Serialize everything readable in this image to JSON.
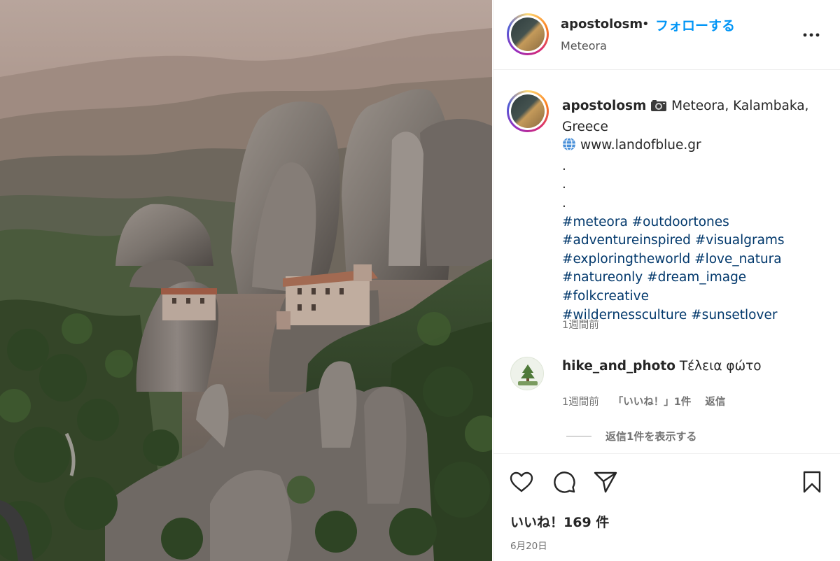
{
  "post": {
    "username": "apostolosm",
    "separator": "•",
    "follow_label": "フォローする",
    "location": "Meteora",
    "more_icon": "more-horizontal-icon"
  },
  "caption": {
    "username": "apostolosm",
    "camera_icon": "camera-icon",
    "location_text": " Meteora, Kalambaka, Greece",
    "globe_icon": "globe-icon",
    "website": "www.landofblue.gr",
    "dot1": ".",
    "dot2": ".",
    "dot3": ".",
    "hashtags_line1": "#meteora #outdoortones",
    "hashtags_line2": "#adventureinspired #visualgrams",
    "hashtags_line3": "#exploringtheworld #love_natura",
    "hashtags_line4": "#natureonly #dream_image #folkcreative",
    "hashtags_line5": "#wildernessculture #sunsetlover",
    "time": "1週間前"
  },
  "comment": {
    "username": "hike_and_photo",
    "text": "Τέλεια φώτο",
    "time": "1週間前",
    "likes": "「いいね！」1件",
    "reply_label": "返信",
    "view_replies": "返信1件を表示する"
  },
  "actions": {
    "like_icon": "heart-icon",
    "comment_icon": "comment-icon",
    "share_icon": "share-icon",
    "save_icon": "bookmark-icon"
  },
  "likes_text": "いいね！169 件",
  "post_date": "6月20日"
}
